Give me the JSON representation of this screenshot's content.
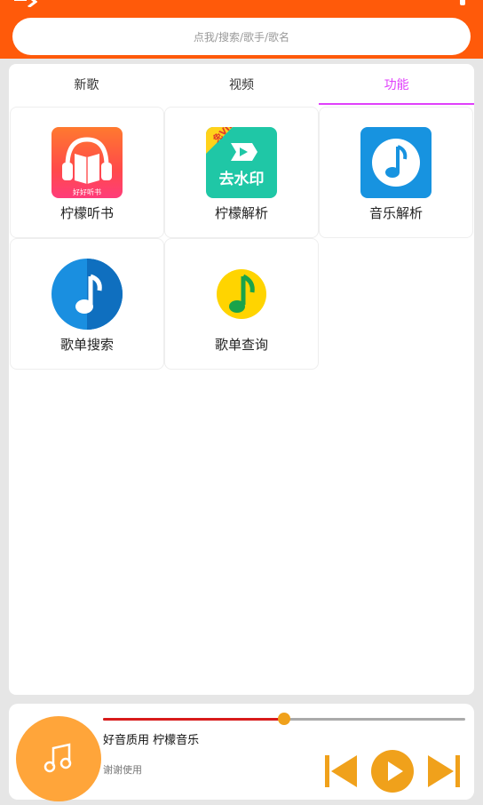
{
  "search": {
    "placeholder": "点我/搜索/歌手/歌名"
  },
  "tabs": [
    {
      "label": "新歌",
      "active": false
    },
    {
      "label": "视频",
      "active": false
    },
    {
      "label": "功能",
      "active": true
    }
  ],
  "functions": [
    {
      "label": "柠檬听书",
      "icon": "audiobook-icon",
      "icon_caption": "好好听书"
    },
    {
      "label": "柠檬解析",
      "icon": "watermark-remove-icon",
      "icon_caption": "去水印",
      "badge": "免VIP"
    },
    {
      "label": "音乐解析",
      "icon": "music-note-square-icon"
    },
    {
      "label": "歌单搜索",
      "icon": "music-note-circle-blue-icon"
    },
    {
      "label": "歌单查询",
      "icon": "qq-music-icon"
    }
  ],
  "player": {
    "title": "好音质用 柠檬音乐",
    "subtitle": "谢谢使用",
    "progress": 0.5
  },
  "colors": {
    "header": "#ff5a0a",
    "accent_tab": "#e040fb",
    "player_accent": "#f0a11b",
    "progress": "#d81b1b"
  }
}
